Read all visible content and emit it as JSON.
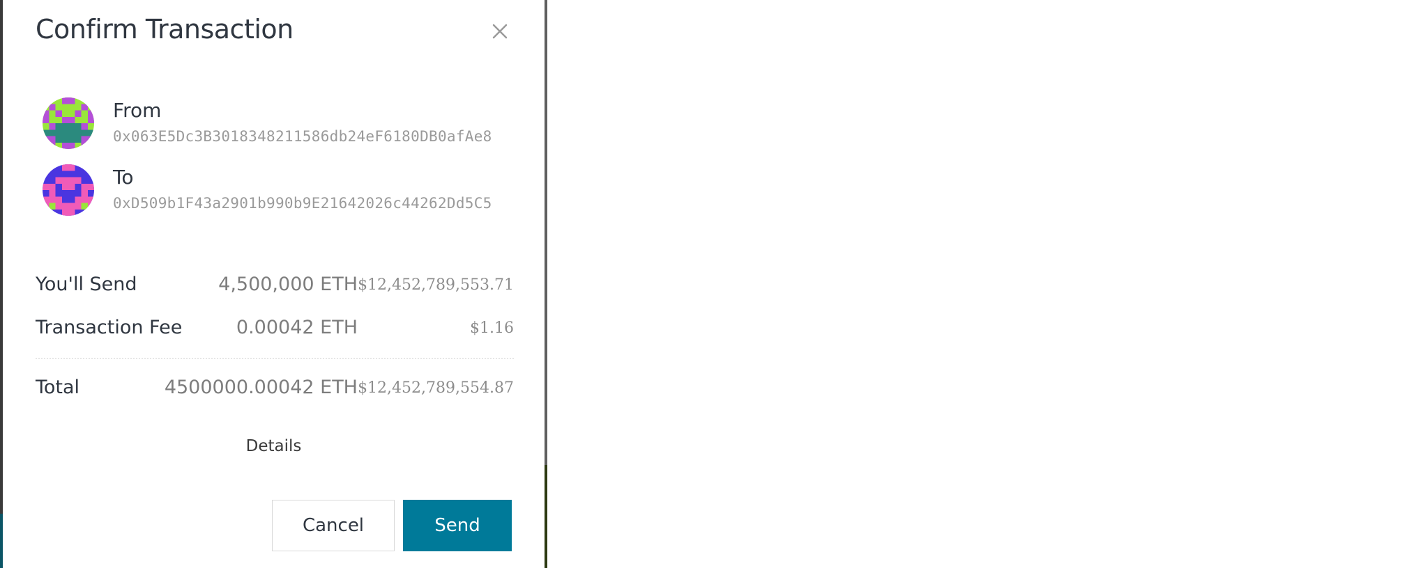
{
  "dialog": {
    "title": "Confirm Transaction",
    "close_icon": "close-icon"
  },
  "from": {
    "label": "From",
    "address": "0x063E5Dc3B3018348211586db24eF6180DB0afAe8",
    "avatar_icon": "identicon-avatar"
  },
  "to": {
    "label": "To",
    "address": "0xD509b1F43a2901b990b9E21642026c44262Dd5C5",
    "avatar_icon": "identicon-avatar"
  },
  "summary": {
    "send": {
      "label": "You'll Send",
      "amount": "4,500,000 ETH",
      "usd": "$12,452,789,553.71"
    },
    "fee": {
      "label": "Transaction Fee",
      "amount": "0.00042 ETH",
      "usd": "$1.16"
    },
    "total": {
      "label": "Total",
      "amount": "4500000.00042 ETH",
      "usd": "$12,452,789,554.87"
    }
  },
  "details_label": "Details",
  "buttons": {
    "cancel": "Cancel",
    "send": "Send"
  },
  "colors": {
    "primary": "#007a99",
    "text": "#2f3640",
    "muted": "#9a9a9a"
  }
}
